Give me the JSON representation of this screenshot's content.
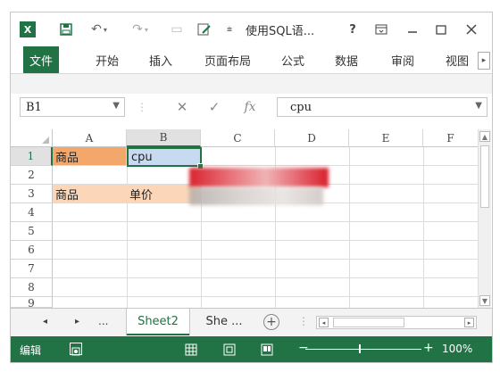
{
  "window": {
    "title": "使用SQL语...",
    "app_logo": "X",
    "help": "?",
    "controls": [
      "restore-ribbon-icon",
      "minimize-icon",
      "maximize-icon",
      "close-icon"
    ]
  },
  "ribbon": {
    "tabs": [
      {
        "label": "文件",
        "active": true
      },
      {
        "label": "开始"
      },
      {
        "label": "插入"
      },
      {
        "label": "页面布局"
      },
      {
        "label": "公式"
      },
      {
        "label": "数据"
      },
      {
        "label": "审阅"
      },
      {
        "label": "视图"
      }
    ]
  },
  "formula_bar": {
    "name_box": "B1",
    "cancel": "✕",
    "enter": "✓",
    "fx": "fx",
    "value": "cpu"
  },
  "grid": {
    "columns": [
      "A",
      "B",
      "C",
      "D",
      "E",
      "F"
    ],
    "rows": [
      "1",
      "2",
      "3",
      "4",
      "5",
      "6",
      "7",
      "8",
      "9"
    ],
    "selected_column": "B",
    "selected_row": "1",
    "cells": {
      "A1": "商品",
      "B1": "cpu",
      "A3": "商品",
      "B3": "单价"
    },
    "colors": {
      "header_fill": "#f4a76b",
      "row3_fill": "#fbd6b8",
      "selection": "#c8daf0",
      "accent": "#217346"
    }
  },
  "sheets": {
    "ellipsis": "...",
    "tabs": [
      {
        "label": "Sheet2",
        "active": true
      },
      {
        "label": "She ..."
      }
    ],
    "add": "+"
  },
  "status": {
    "mode": "编辑",
    "zoom": "100%",
    "zoom_minus": "−",
    "zoom_plus": "+"
  }
}
